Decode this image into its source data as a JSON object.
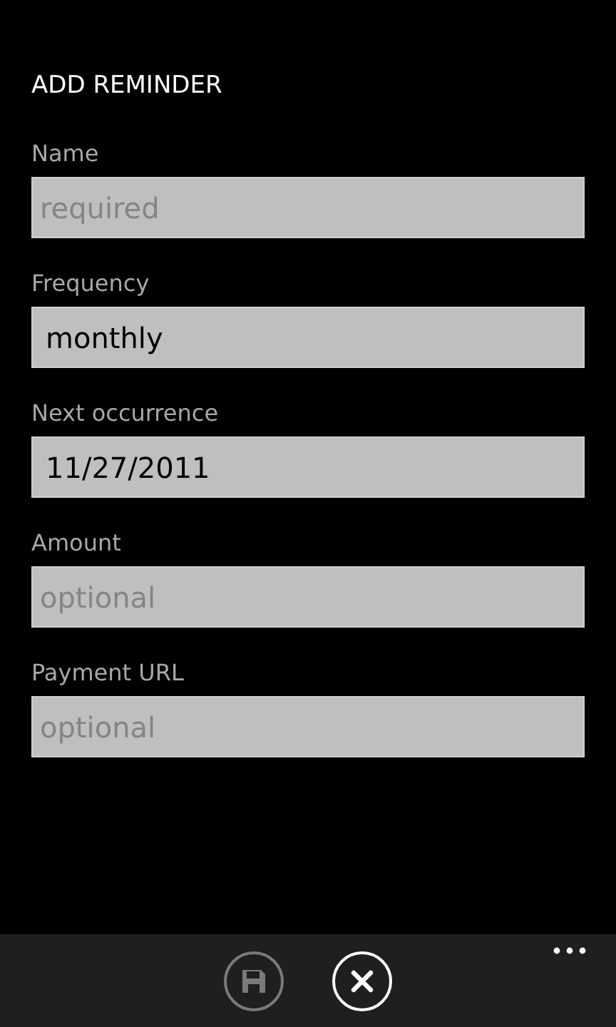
{
  "title": "ADD REMINDER",
  "fields": [
    {
      "label": "Name",
      "placeholder": "required"
    },
    {
      "label": "Frequency",
      "value": "monthly"
    },
    {
      "label": "Next occurrence",
      "value": "11/27/2011"
    },
    {
      "label": "Amount",
      "placeholder": "optional"
    },
    {
      "label": "Payment URL",
      "placeholder": "optional"
    }
  ],
  "app_bar": {
    "buttons": [
      {
        "kind": "save",
        "disabled": true
      },
      {
        "kind": "cancel",
        "disabled": false
      }
    ]
  }
}
